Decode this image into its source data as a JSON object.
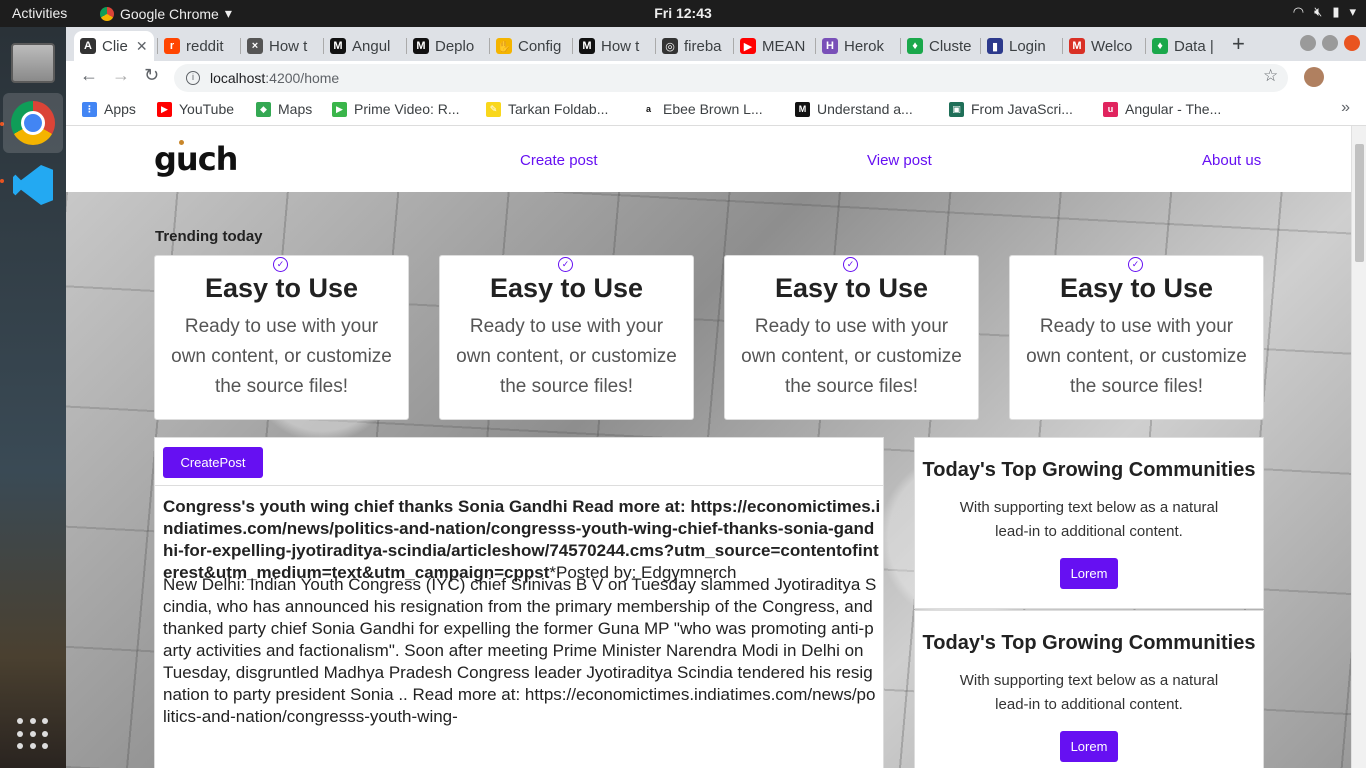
{
  "os": {
    "activities": "Activities",
    "app_name": "Google Chrome",
    "clock": "Fri 12:43"
  },
  "tabs": [
    {
      "label": "Clie",
      "color": "#333333",
      "glyph": "A"
    },
    {
      "label": "reddit",
      "color": "#ff4500",
      "glyph": "r"
    },
    {
      "label": "How t",
      "color": "#555555",
      "glyph": "×"
    },
    {
      "label": "Angul",
      "color": "#111111",
      "glyph": "M"
    },
    {
      "label": "Deplo",
      "color": "#111111",
      "glyph": "M"
    },
    {
      "label": "Config",
      "color": "#f4b400",
      "glyph": "✋"
    },
    {
      "label": "How t",
      "color": "#111111",
      "glyph": "M"
    },
    {
      "label": "fireba",
      "color": "#333333",
      "glyph": "◎"
    },
    {
      "label": "MEAN",
      "color": "#ff0000",
      "glyph": "▶"
    },
    {
      "label": "Herok",
      "color": "#7950b8",
      "glyph": "H"
    },
    {
      "label": "Cluste",
      "color": "#1aa84b",
      "glyph": "♦"
    },
    {
      "label": "Login",
      "color": "#2d3a8c",
      "glyph": "▮"
    },
    {
      "label": "Welco",
      "color": "#d93025",
      "glyph": "M"
    },
    {
      "label": "Data |",
      "color": "#1aa84b",
      "glyph": "♦"
    }
  ],
  "browser": {
    "url_host": "localhost",
    "url_path": ":4200/home"
  },
  "bookmarks": [
    {
      "label": "Apps",
      "color": "#4285f4",
      "glyph": "⋮"
    },
    {
      "label": "YouTube",
      "color": "#ff0000",
      "glyph": "▶"
    },
    {
      "label": "Maps",
      "color": "#34a853",
      "glyph": "◆"
    },
    {
      "label": "Prime Video: R...",
      "color": "#3ab54a",
      "glyph": "▶"
    },
    {
      "label": "Tarkan Foldab...",
      "color": "#f9d71c",
      "glyph": "✎"
    },
    {
      "label": "Ebee Brown L...",
      "color": "#ffffff",
      "glyph": "a"
    },
    {
      "label": "Understand a...",
      "color": "#111111",
      "glyph": "M"
    },
    {
      "label": "From JavaScri...",
      "color": "#1f6f58",
      "glyph": "▣"
    },
    {
      "label": "Angular - The...",
      "color": "#e0245e",
      "glyph": "u"
    }
  ],
  "site": {
    "logo": "guch",
    "nav": [
      "Create post",
      "View post",
      "About us"
    ],
    "trending_label": "Trending today",
    "features": [
      {
        "title": "Easy to Use",
        "text": "Ready to use with your own content, or customize the source files!"
      },
      {
        "title": "Easy to Use",
        "text": "Ready to use with your own content, or customize the source files!"
      },
      {
        "title": "Easy to Use",
        "text": "Ready to use with your own content, or customize the source files!"
      },
      {
        "title": "Easy to Use",
        "text": "Ready to use with your own content, or customize the source files!"
      }
    ],
    "create_post_button": "CreatePost",
    "post": {
      "title": "Congress's youth wing chief thanks Sonia Gandhi Read more at: https://economictimes.indiatimes.com/news/politics-and-nation/congresss-youth-wing-chief-thanks-sonia-gandhi-for-expelling-jyotiraditya-scindia/articleshow/74570244.cms?utm_source=contentofinterest&utm_medium=text&utm_campaign=cppst",
      "posted_by": "*Posted by: Edgymnerch",
      "body": "New Delhi: Indian Youth Congress (IYC) chief Srinivas B V on Tuesday slammed Jyotiraditya Scindia, who has announced his resignation from the primary membership of the Congress, and thanked party chief Sonia Gandhi for expelling the former Guna MP \"who was promoting anti-party activities and factionalism\". Soon after meeting Prime Minister Narendra Modi in Delhi on Tuesday, disgruntled Madhya Pradesh Congress leader Jyotiraditya Scindia tendered his resignation to party president Sonia .. Read more at: https://economictimes.indiatimes.com/news/politics-and-nation/congresss-youth-wing-"
    },
    "side_cards": [
      {
        "title": "Today's Top Growing Communities",
        "text": "With supporting text below as a natural lead-in to additional content.",
        "button": "Lorem"
      },
      {
        "title": "Today's Top Growing Communities",
        "text": "With supporting text below as a natural lead-in to additional content.",
        "button": "Lorem"
      }
    ]
  }
}
